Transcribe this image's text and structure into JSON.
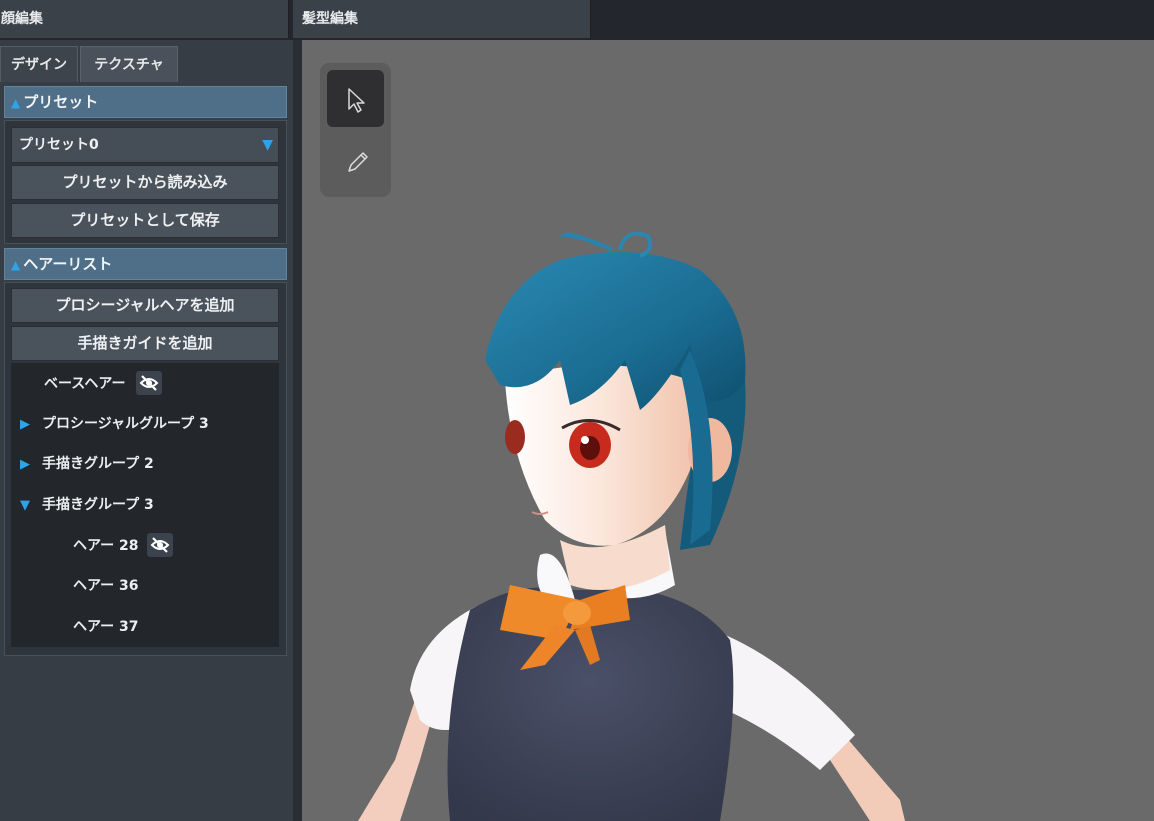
{
  "top_tabs": {
    "face": "顔編集",
    "hair": "髪型編集"
  },
  "sub_tabs": {
    "design": "デザイン",
    "texture": "テクスチャ"
  },
  "preset_section": {
    "title": "プリセット",
    "selected": "プリセット0",
    "load_label": "プリセットから読み込み",
    "save_label": "プリセットとして保存"
  },
  "hair_list_section": {
    "title": "ヘアーリスト",
    "add_procedural_label": "プロシージャルヘアを追加",
    "add_guide_label": "手描きガイドを追加",
    "items": [
      {
        "label": "ベースヘアー",
        "hidden": true
      },
      {
        "label": "プロシージャルグループ 3",
        "expanded": false
      },
      {
        "label": "手描きグループ 2",
        "expanded": false
      },
      {
        "label": "手描きグループ 3",
        "expanded": true
      },
      {
        "label": "ヘアー 28",
        "hidden": true
      },
      {
        "label": "ヘアー 36"
      },
      {
        "label": "ヘアー 37"
      }
    ]
  },
  "viewport_tools": {
    "icons": [
      "cursor-icon",
      "pencil-icon"
    ],
    "active": "cursor-icon"
  },
  "colors": {
    "accent": "#2fa3ea",
    "hair": "#1d6f93",
    "eyes": "#c62b1e",
    "bow": "#ef8a2b",
    "vest": "#3e4357",
    "viewport_bg": "#6a6a6a"
  }
}
